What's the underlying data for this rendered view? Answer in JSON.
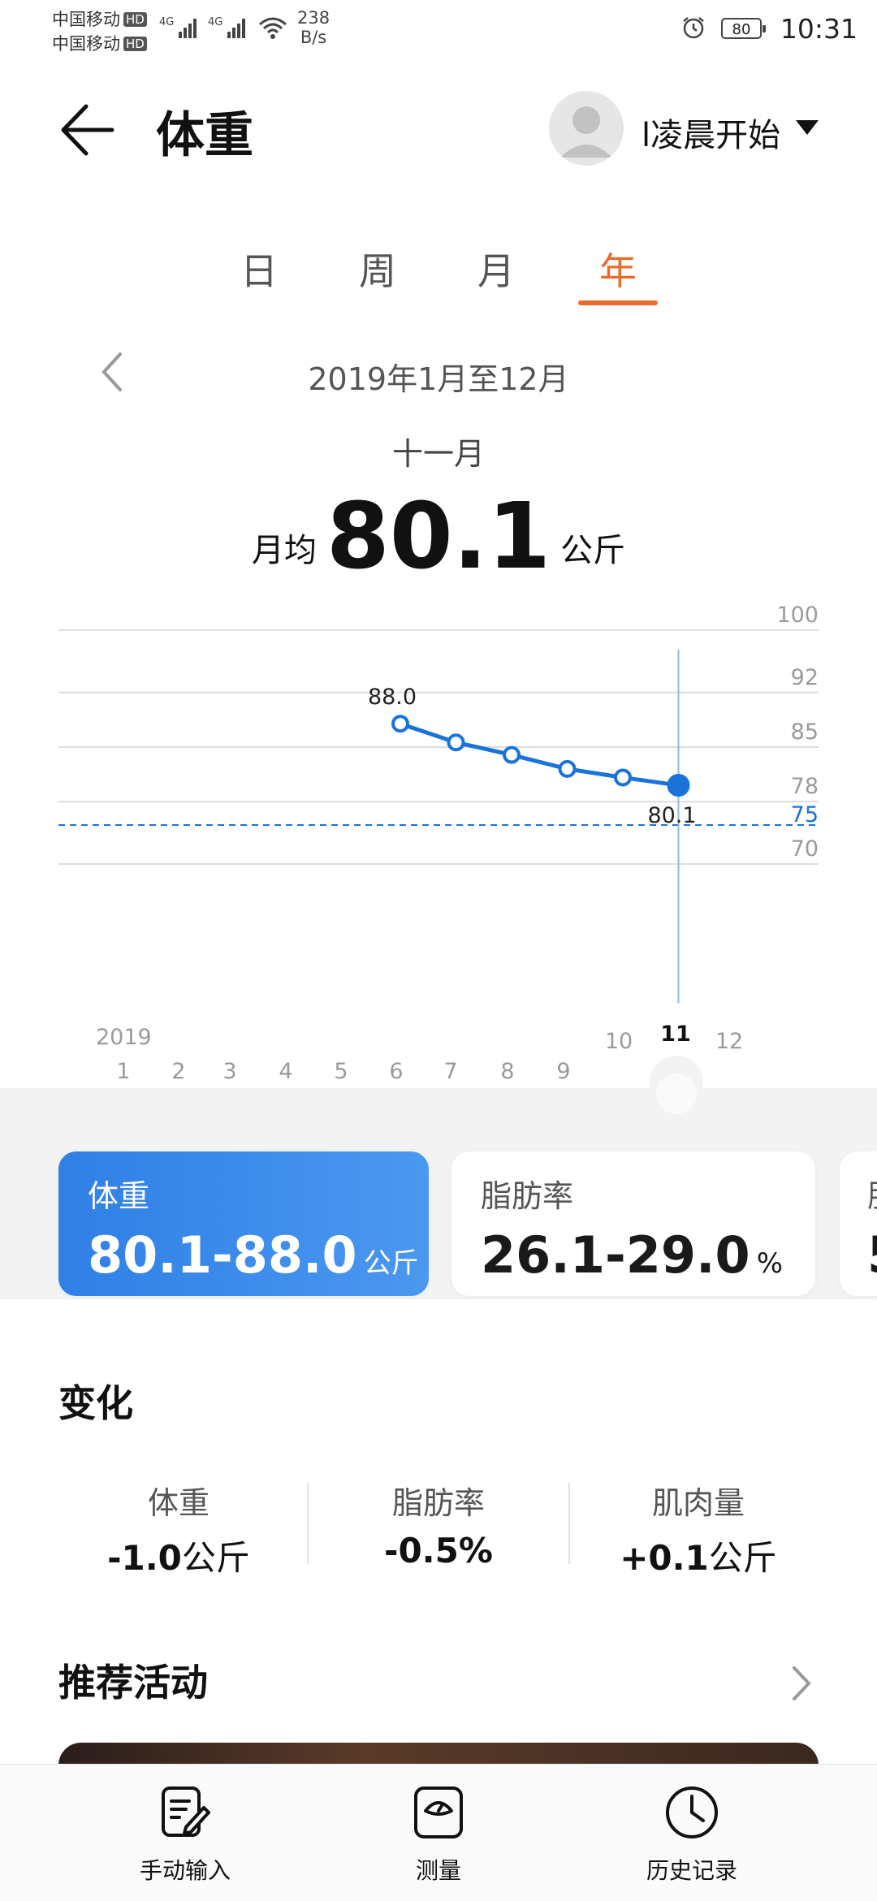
{
  "status_bar": {
    "carrier1": "中国移动",
    "carrier2": "中国移动",
    "hd": "HD",
    "net1": "4G",
    "net2": "4G",
    "speed_value": "238",
    "speed_unit": "B/s",
    "battery": "80",
    "time": "10:31"
  },
  "header": {
    "title": "体重",
    "user_name": "l凌晨开始"
  },
  "tabs": [
    {
      "label": "日",
      "active": false
    },
    {
      "label": "周",
      "active": false
    },
    {
      "label": "月",
      "active": false
    },
    {
      "label": "年",
      "active": true
    }
  ],
  "period": {
    "range": "2019年1月至12月",
    "selected_month": "十一月"
  },
  "summary": {
    "label": "月均",
    "value": "80.1",
    "unit": "公斤"
  },
  "chart_data": {
    "type": "line",
    "year_label": "2019",
    "x_ticks": [
      "1",
      "2",
      "3",
      "4",
      "5",
      "6",
      "7",
      "8",
      "9",
      "10",
      "11",
      "12"
    ],
    "y_ticks": [
      100,
      92,
      85,
      78,
      70
    ],
    "ylim": [
      64.6,
      100
    ],
    "grid": true,
    "series": [
      {
        "x": [
          6,
          7,
          8,
          9,
          10,
          11
        ],
        "values": [
          88.0,
          85.6,
          84.0,
          82.2,
          81.1,
          80.1
        ]
      }
    ],
    "point_labels": {
      "first": "88.0",
      "last": "80.1"
    },
    "target_line": {
      "value": 75,
      "label": "75"
    },
    "selected_x": 11,
    "colors": {
      "line": "#1a73d9",
      "target": "#1a73d9",
      "grid": "#dddddd",
      "tick": "#9a9a9a"
    }
  },
  "cards": [
    {
      "title": "体重",
      "value": "80.1-88.0",
      "unit": "公斤",
      "active": true
    },
    {
      "title": "脂肪率",
      "value": "26.1-29.0",
      "unit": "%",
      "active": false
    },
    {
      "title": "肌",
      "value": "5",
      "unit": "",
      "active": false
    }
  ],
  "changes": {
    "title": "变化",
    "items": [
      {
        "label": "体重",
        "value": "-1.0",
        "unit": "公斤"
      },
      {
        "label": "脂肪率",
        "value": "-0.5%",
        "unit": ""
      },
      {
        "label": "肌肉量",
        "value": "+0.1",
        "unit": "公斤"
      }
    ]
  },
  "recommend": {
    "title": "推荐活动"
  },
  "bottom_nav": [
    {
      "label": "手动输入",
      "icon": "edit-icon"
    },
    {
      "label": "测量",
      "icon": "scale-icon"
    },
    {
      "label": "历史记录",
      "icon": "clock-icon"
    }
  ]
}
